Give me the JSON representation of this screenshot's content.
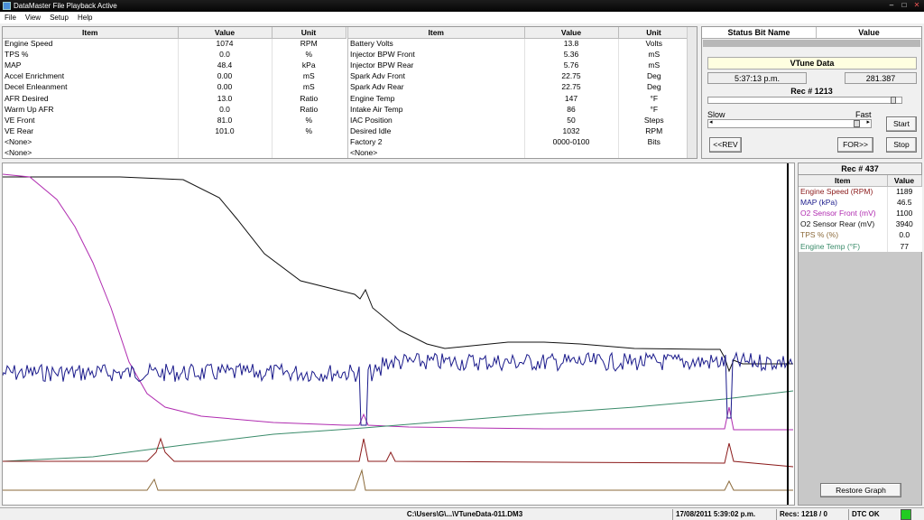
{
  "window": {
    "title": "DataMaster File Playback Active",
    "min": "–",
    "max": "□",
    "close": "✕"
  },
  "menu": [
    "File",
    "View",
    "Setup",
    "Help"
  ],
  "table_headers": {
    "item": "Item",
    "value": "Value",
    "unit": "Unit"
  },
  "left_table": [
    {
      "item": "Engine Speed",
      "value": "1074",
      "unit": "RPM"
    },
    {
      "item": "TPS %",
      "value": "0.0",
      "unit": "%"
    },
    {
      "item": "MAP",
      "value": "48.4",
      "unit": "kPa"
    },
    {
      "item": "Accel Enrichment",
      "value": "0.00",
      "unit": "mS"
    },
    {
      "item": "Decel Enleanment",
      "value": "0.00",
      "unit": "mS"
    },
    {
      "item": "AFR Desired",
      "value": "13.0",
      "unit": "Ratio"
    },
    {
      "item": "Warm Up AFR",
      "value": "0.0",
      "unit": "Ratio"
    },
    {
      "item": "VE Front",
      "value": "81.0",
      "unit": "%"
    },
    {
      "item": "VE Rear",
      "value": "101.0",
      "unit": "%"
    },
    {
      "item": "<None>",
      "value": "",
      "unit": ""
    },
    {
      "item": "<None>",
      "value": "",
      "unit": ""
    }
  ],
  "right_table": [
    {
      "item": "Battery Volts",
      "value": "13.8",
      "unit": "Volts"
    },
    {
      "item": "Injector BPW Front",
      "value": "5.36",
      "unit": "mS"
    },
    {
      "item": "Injector BPW Rear",
      "value": "5.76",
      "unit": "mS"
    },
    {
      "item": "Spark Adv Front",
      "value": "22.75",
      "unit": "Deg"
    },
    {
      "item": "Spark Adv Rear",
      "value": "22.75",
      "unit": "Deg"
    },
    {
      "item": "Engine Temp",
      "value": "147",
      "unit": "°F"
    },
    {
      "item": "Intake Air Temp",
      "value": "86",
      "unit": "°F"
    },
    {
      "item": "IAC Position",
      "value": "50",
      "unit": "Steps"
    },
    {
      "item": "Desired Idle",
      "value": "1032",
      "unit": "RPM"
    },
    {
      "item": "Factory 2",
      "value": "0000-0100",
      "unit": "Bits"
    },
    {
      "item": "<None>",
      "value": "",
      "unit": ""
    }
  ],
  "status_bits": {
    "col_name": "Status Bit Name",
    "col_value": "Value"
  },
  "playback": {
    "title": "VTune Data",
    "time": "5:37:13 p.m.",
    "elapsed": "281.387",
    "rec_label": "Rec # 1213",
    "rec_position": 0.97,
    "slow": "Slow",
    "fast": "Fast",
    "speed_position": 0.97,
    "start": "Start",
    "rev": "<<REV",
    "for": "FOR>>",
    "stop": "Stop"
  },
  "legend": {
    "rec_label": "Rec # 437",
    "col_item": "Item",
    "col_value": "Value",
    "rows": [
      {
        "item": "Engine Speed (RPM)",
        "value": "1189",
        "color": "#8b1a1a"
      },
      {
        "item": "MAP (kPa)",
        "value": "46.5",
        "color": "#1a1a8b"
      },
      {
        "item": "O2 Sensor Front (mV)",
        "value": "1100",
        "color": "#b02cb0"
      },
      {
        "item": "O2 Sensor Rear (mV)",
        "value": "3940",
        "color": "#111111"
      },
      {
        "item": "TPS % (%)",
        "value": "0.0",
        "color": "#8b6a3a"
      },
      {
        "item": "Engine Temp (°F)",
        "value": "77",
        "color": "#3a8b6a"
      }
    ],
    "restore": "Restore Graph"
  },
  "statusbar": {
    "file": "C:\\Users\\G\\...\\VTuneData-011.DM3",
    "datetime": "17/08/2011  5:39:02 p.m.",
    "recs": "Recs: 1218 / 0",
    "dtc": "DTC OK",
    "dtc_color": "#22cc22"
  }
}
